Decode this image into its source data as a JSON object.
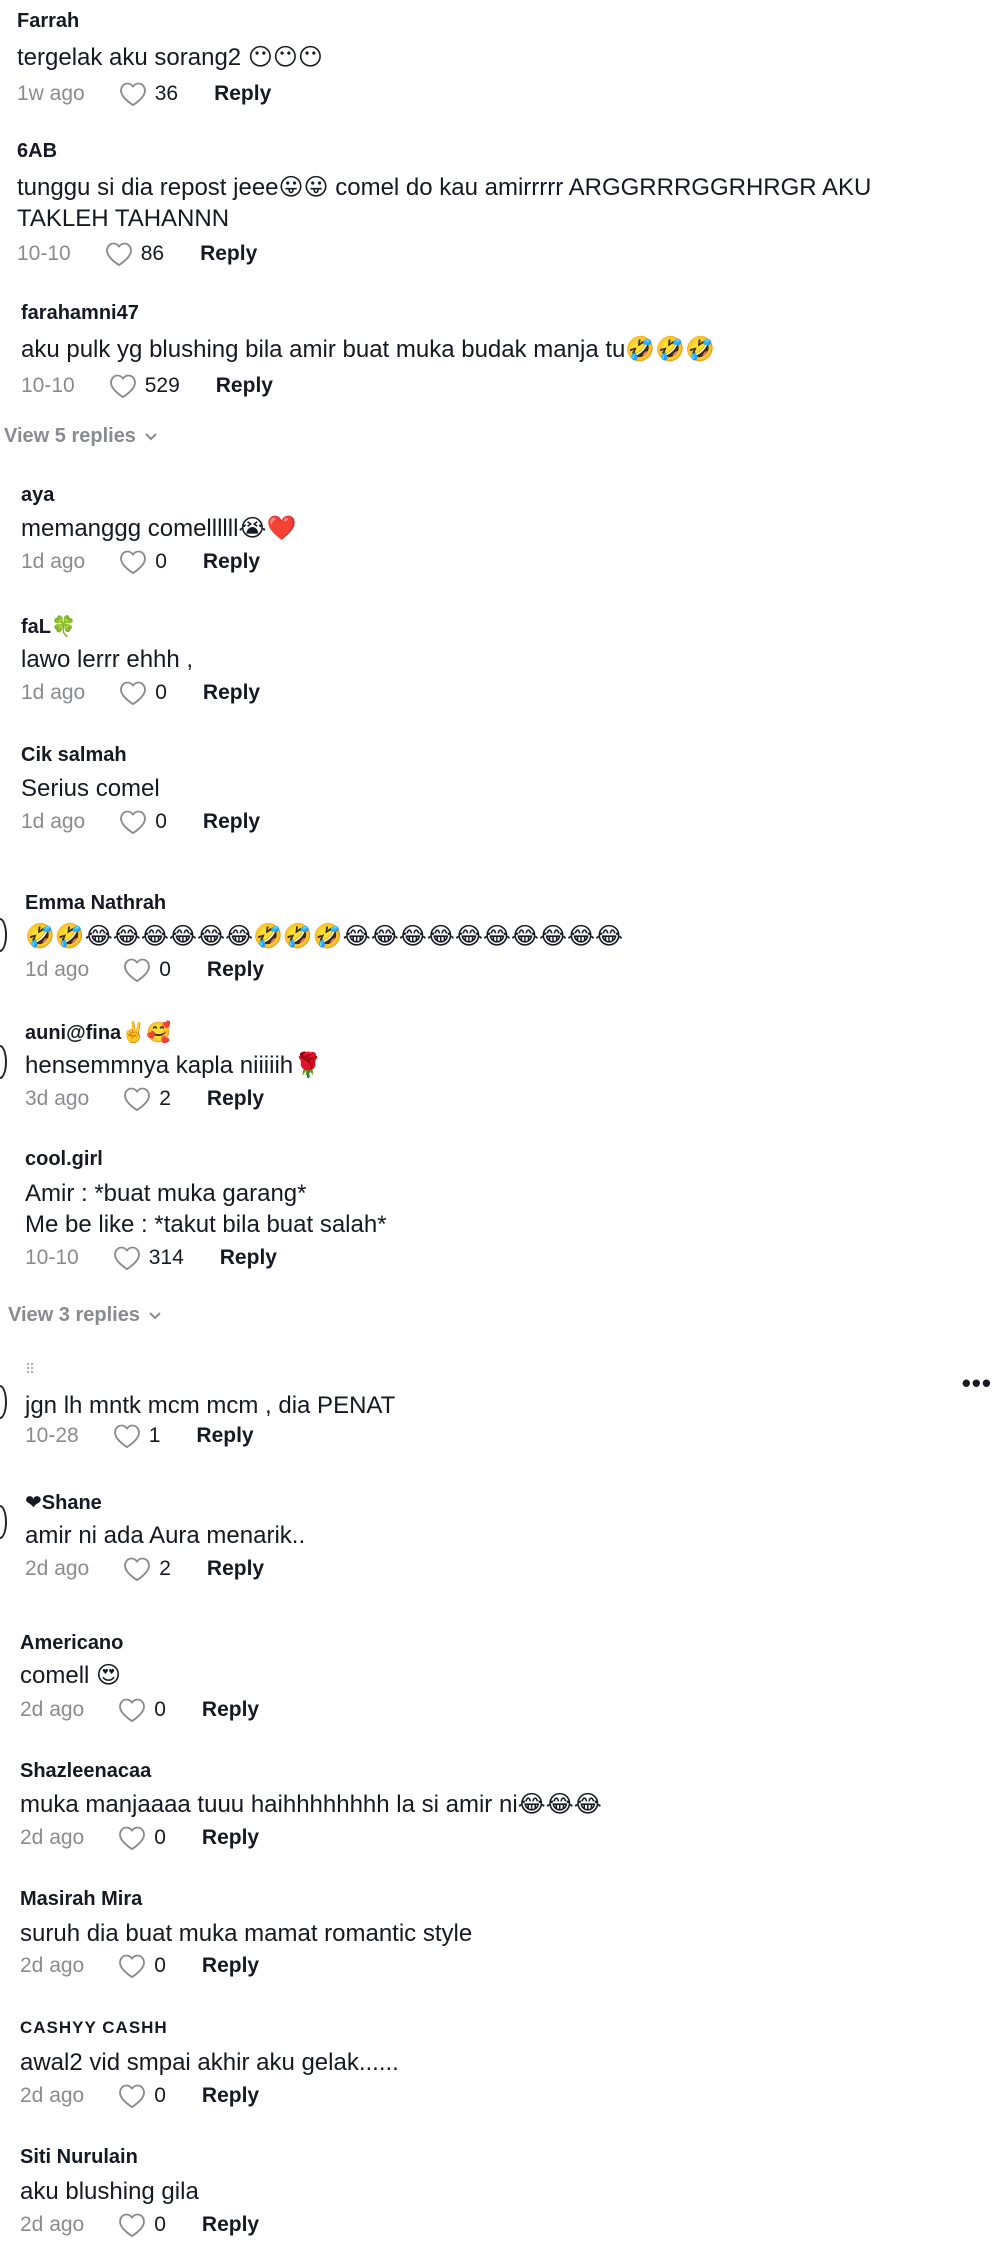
{
  "comments": [
    {
      "user": "Farrah",
      "text": [
        "tergelak aku sorang2 😶😶😶"
      ],
      "time": "1w ago",
      "likes": "36",
      "reply": "Reply"
    },
    {
      "user": "6AB",
      "text": [
        "tunggu si dia repost jeee😛😛 comel do kau amirrrrr ARGGRRRGGRHRGR AKU",
        "TAKLEH TAHANNN"
      ],
      "time": "10-10",
      "likes": "86",
      "reply": "Reply"
    },
    {
      "user": "farahamni47",
      "text": [
        "aku pulk yg blushing bila amir buat muka budak manja tu🤣🤣🤣"
      ],
      "time": "10-10",
      "likes": "529",
      "reply": "Reply"
    },
    {
      "user": "aya",
      "text": [
        "memanggg comellllll😭❤️"
      ],
      "time": "1d ago",
      "likes": "0",
      "reply": "Reply"
    },
    {
      "user": "faL🍀",
      "text": [
        "lawo lerrr ehhh ,"
      ],
      "time": "1d ago",
      "likes": "0",
      "reply": "Reply"
    },
    {
      "user": "Cik salmah",
      "text": [
        "Serius comel"
      ],
      "time": "1d ago",
      "likes": "0",
      "reply": "Reply"
    },
    {
      "user": "Emma Nathrah",
      "text": [
        "🤣🤣😂😂😂😂😂😂🤣🤣🤣😂😂😂😂😂😂😂😂😂😂"
      ],
      "time": "1d ago",
      "likes": "0",
      "reply": "Reply"
    },
    {
      "user": "auni@fina✌️🥰",
      "text": [
        "hensemmnya kapla niiiiih🌹"
      ],
      "time": "3d ago",
      "likes": "2",
      "reply": "Reply"
    },
    {
      "user": "cool.girl",
      "text": [
        "Amir : *buat muka garang*",
        "Me be like : *takut bila buat salah*"
      ],
      "time": "10-10",
      "likes": "314",
      "reply": "Reply"
    },
    {
      "user": "",
      "text": [
        "jgn lh mntk mcm mcm , dia PENAT"
      ],
      "time": "10-28",
      "likes": "1",
      "reply": "Reply"
    },
    {
      "user": "❤Shane",
      "text": [
        "amir ni ada Aura menarik.."
      ],
      "time": "2d ago",
      "likes": "2",
      "reply": "Reply"
    },
    {
      "user": "Americano",
      "text": [
        "comell 😍"
      ],
      "time": "2d ago",
      "likes": "0",
      "reply": "Reply"
    },
    {
      "user": "Shazleenacaa",
      "text": [
        "muka manjaaaa tuuu haihhhhhhhh la si amir ni😂😂😂"
      ],
      "time": "2d ago",
      "likes": "0",
      "reply": "Reply"
    },
    {
      "user": "Masirah Mira",
      "text": [
        "suruh dia buat muka mamat romantic style"
      ],
      "time": "2d ago",
      "likes": "0",
      "reply": "Reply"
    },
    {
      "user": "CASHYY CASHH",
      "text": [
        "awal2 vid smpai akhir aku gelak......"
      ],
      "time": "2d ago",
      "likes": "0",
      "reply": "Reply"
    },
    {
      "user": "Siti Nurulain",
      "text": [
        "aku blushing gila"
      ],
      "time": "2d ago",
      "likes": "0",
      "reply": "Reply"
    }
  ],
  "view_replies": [
    "View 5 replies",
    "View 3 replies"
  ],
  "icons": {
    "like": "heart-outline-icon",
    "chevron": "chevron-down-icon",
    "more": "more-options-icon",
    "grip": "drag-handle-icon"
  },
  "colors": {
    "text": "#161823",
    "muted": "#8a8b91"
  }
}
